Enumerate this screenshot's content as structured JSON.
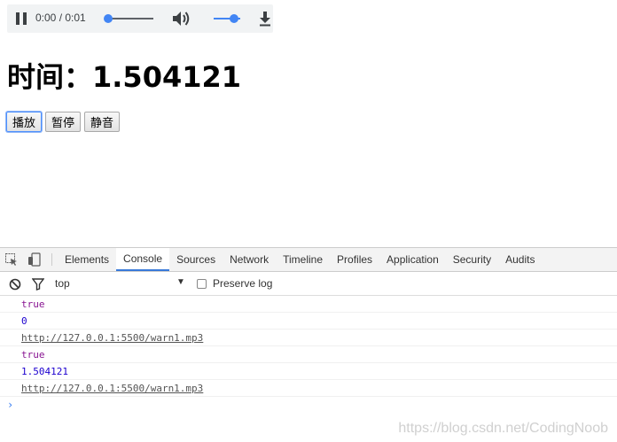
{
  "audio": {
    "time_display": "0:00 / 0:01",
    "seek_progress": 0,
    "volume_level": 1,
    "state": "playing"
  },
  "heading": {
    "text": "时间：1.504121"
  },
  "buttons": {
    "play": "播放",
    "pause": "暂停",
    "mute": "静音"
  },
  "devtools": {
    "tabs": [
      "Elements",
      "Console",
      "Sources",
      "Network",
      "Timeline",
      "Profiles",
      "Application",
      "Security",
      "Audits"
    ],
    "active_tab": "Console",
    "context": "top",
    "preserve_log_label": "Preserve log",
    "preserve_log_checked": false,
    "logs": [
      {
        "type": "bool",
        "text": "true"
      },
      {
        "type": "num",
        "text": "0"
      },
      {
        "type": "url",
        "text": "http://127.0.0.1:5500/warn1.mp3"
      },
      {
        "type": "bool",
        "text": "true"
      },
      {
        "type": "num",
        "text": "1.504121"
      },
      {
        "type": "url",
        "text": "http://127.0.0.1:5500/warn1.mp3"
      }
    ],
    "prompt": "›"
  },
  "watermark": "https://blog.csdn.net/CodingNoob",
  "colors": {
    "accent": "#4285f4",
    "active_tab": "#3879d9",
    "bool": "#881391",
    "number": "#1c00cf"
  }
}
